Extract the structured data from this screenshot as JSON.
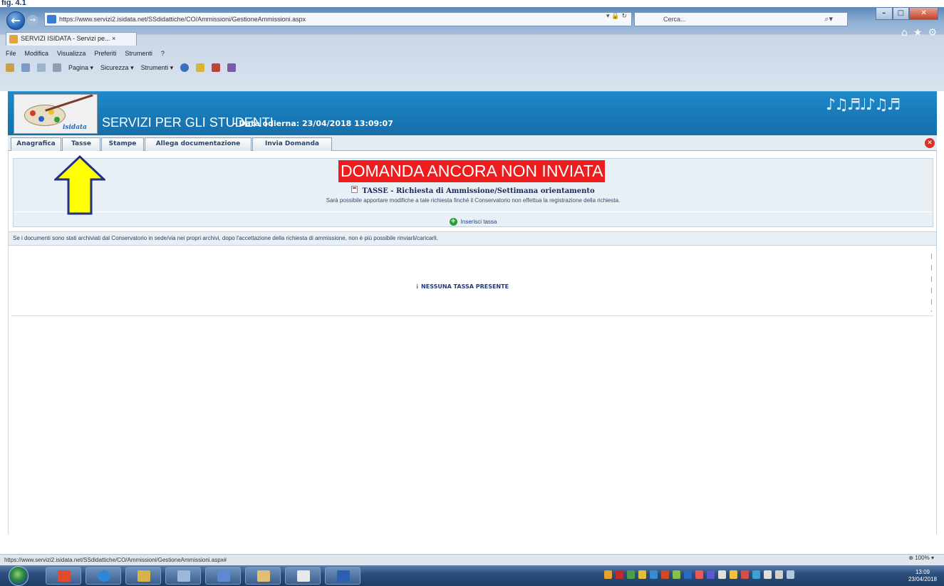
{
  "figure_caption": "fig. 4.1",
  "browser": {
    "url": "https://www.servizi2.isidata.net/SSdidattiche/CO/Ammissioni/GestioneAmmissioni.aspx",
    "search_placeholder": "Cerca...",
    "tab_title": "SERVIZI ISIDATA - Servizi pe... ×",
    "menu": [
      "File",
      "Modifica",
      "Visualizza",
      "Preferiti",
      "Strumenti",
      "?"
    ],
    "command_bar": [
      "Pagina ▾",
      "Sicurezza ▾",
      "Strumenti ▾"
    ],
    "status_url": "https://www.servizi2.isidata.net/SSdidattiche/CO/Ammissioni/GestioneAmmissioni.aspx#",
    "zoom": "100%",
    "clock_time": "13:09",
    "clock_date": "23/04/2018"
  },
  "header": {
    "logo_text": "isidata",
    "title": "SERVIZI PER GLI STUDENTI",
    "date_line": "- Data odierna: 23/04/2018 13:09:07"
  },
  "tabs": [
    "Anagrafica",
    "Tasse",
    "Stampe",
    "Allega documentazione",
    "Invia Domanda"
  ],
  "status_banner": "DOMANDA ANCORA NON INVIATA",
  "section": {
    "title": "TASSE - Richiesta di Ammissione/Settimana orientamento",
    "note": "Sarà possibile apportare modifiche a tale richiesta finché il Conservatorio non effettua la registrazione della richiesta.",
    "insert_label": "Inserisci tassa"
  },
  "info_text": "Se i documenti sono stati archiviati dal Conservatorio in sede/via nei propri archivi, dopo l'accettazione della richiesta di ammissione, non è più possibile rinviarli/caricarli.",
  "empty_message": "NESSUNA TASSA PRESENTE",
  "colors": {
    "header_blue": "#1878b6",
    "banner_red": "#ee1c1c",
    "arrow_yellow": "#ffff00",
    "arrow_outline": "#1f2f8a"
  }
}
